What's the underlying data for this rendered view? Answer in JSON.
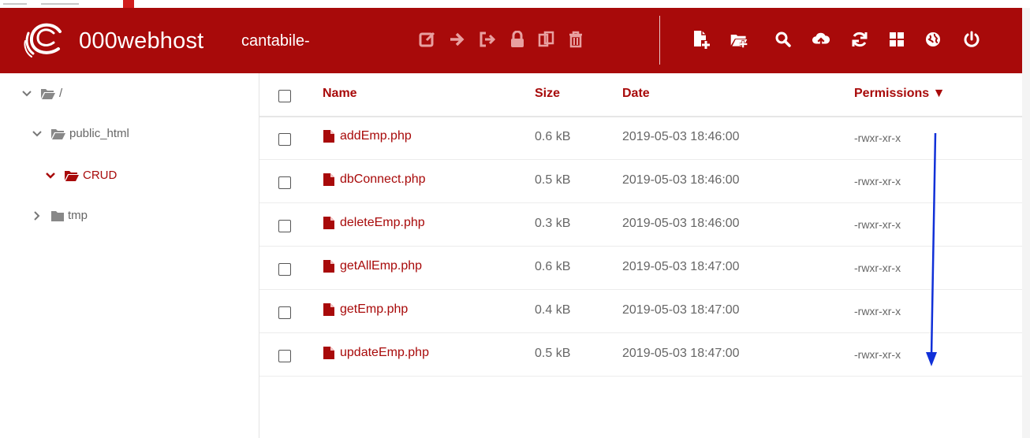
{
  "header": {
    "brand": "000webhost",
    "site_name": "cantabile-"
  },
  "toolbar_left_icons": [
    "edit-icon",
    "arrow-right-icon",
    "sign-out-icon",
    "lock-icon",
    "copy-icon",
    "trash-icon"
  ],
  "toolbar_right_icons": [
    "new-file-icon",
    "new-folder-icon",
    "search-icon",
    "upload-cloud-icon",
    "refresh-icon",
    "grid-icon",
    "globe-icon",
    "power-icon"
  ],
  "sidebar": {
    "items": [
      {
        "label": "/",
        "state": "expanded"
      },
      {
        "label": "public_html",
        "state": "expanded"
      },
      {
        "label": "CRUD",
        "state": "expanded",
        "active": true
      },
      {
        "label": "tmp",
        "state": "collapsed"
      }
    ]
  },
  "table": {
    "columns": {
      "name": "Name",
      "size": "Size",
      "date": "Date",
      "permissions": "Permissions ▼"
    },
    "rows": [
      {
        "name": "addEmp.php",
        "size": "0.6 kB",
        "date": "2019-05-03 18:46:00",
        "perm": "-rwxr-xr-x"
      },
      {
        "name": "dbConnect.php",
        "size": "0.5 kB",
        "date": "2019-05-03 18:46:00",
        "perm": "-rwxr-xr-x"
      },
      {
        "name": "deleteEmp.php",
        "size": "0.3 kB",
        "date": "2019-05-03 18:46:00",
        "perm": "-rwxr-xr-x"
      },
      {
        "name": "getAllEmp.php",
        "size": "0.6 kB",
        "date": "2019-05-03 18:47:00",
        "perm": "-rwxr-xr-x"
      },
      {
        "name": "getEmp.php",
        "size": "0.4 kB",
        "date": "2019-05-03 18:47:00",
        "perm": "-rwxr-xr-x"
      },
      {
        "name": "updateEmp.php",
        "size": "0.5 kB",
        "date": "2019-05-03 18:47:00",
        "perm": "-rwxr-xr-x"
      }
    ]
  },
  "colors": {
    "brand": "#a80a0a",
    "header_icons_left": "#e8a0a0",
    "annotation_arrow": "#1030d8"
  }
}
